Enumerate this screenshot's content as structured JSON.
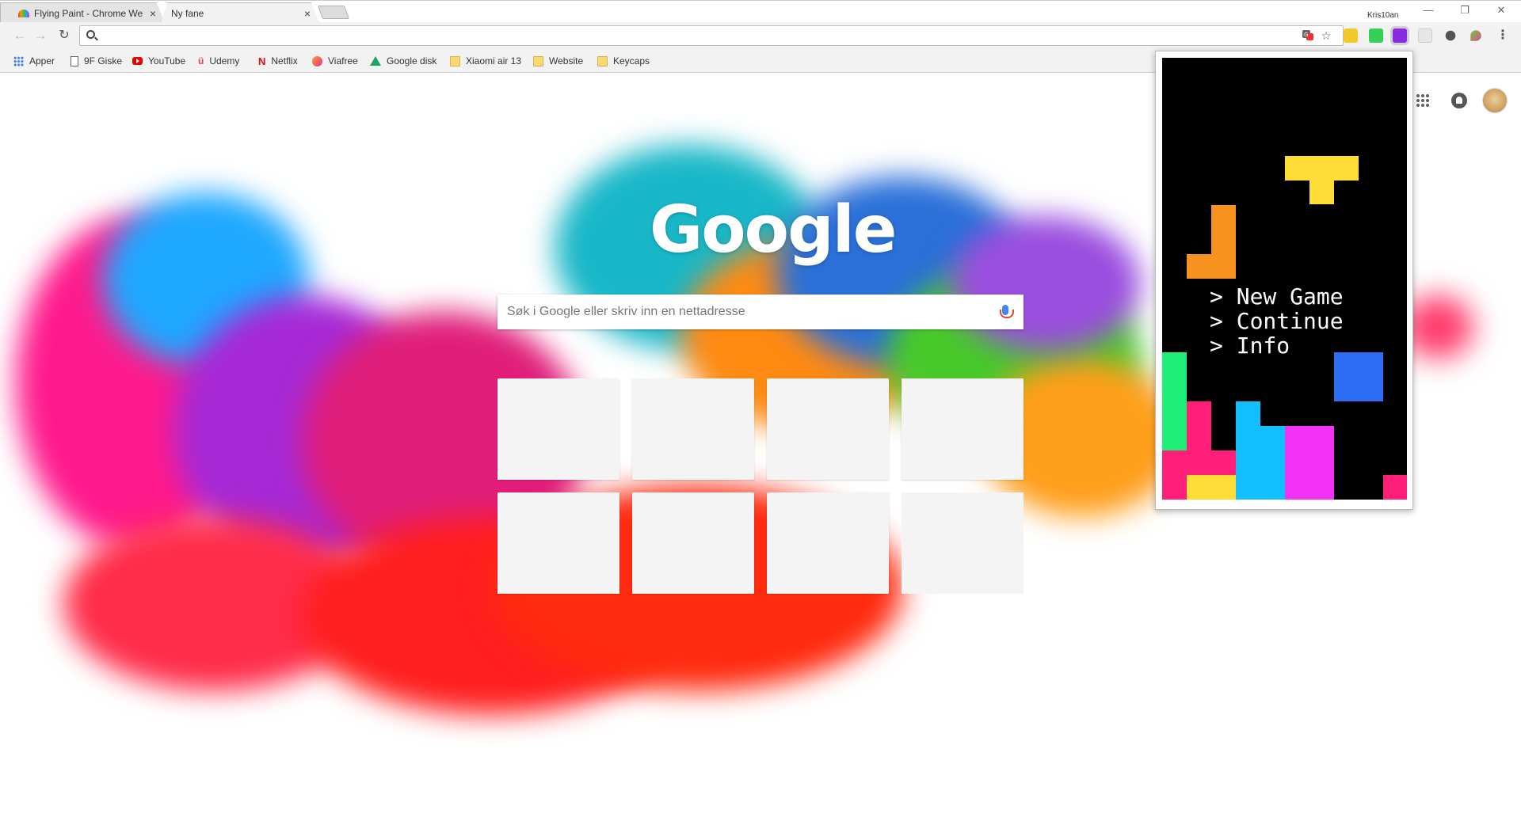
{
  "tabs": [
    {
      "label": "Flying Paint - Chrome We",
      "close": "×",
      "active": false
    },
    {
      "label": "Ny fane",
      "close": "×",
      "active": true
    }
  ],
  "window": {
    "user": "Kris10an",
    "minimize": "—",
    "restore": "❐",
    "close": "✕"
  },
  "toolbar": {
    "back": "←",
    "forward": "→",
    "reload": "↻",
    "address_value": "",
    "translate_icon": "translate-icon",
    "star": "☆",
    "menu": "⋮",
    "extensions": [
      "#f2c82b",
      "#33d155",
      "#8a2be2",
      "#d9d9d9",
      "#555555",
      "#7ac943"
    ]
  },
  "bookmarks": [
    {
      "label": "Apper",
      "icon": "apps-icon"
    },
    {
      "label": "9F Giske",
      "icon": "page-icon"
    },
    {
      "label": "YouTube",
      "icon": "youtube-icon"
    },
    {
      "label": "Udemy",
      "icon": "udemy-icon",
      "glyph": "ü"
    },
    {
      "label": "Netflix",
      "icon": "netflix-icon",
      "glyph": "N"
    },
    {
      "label": "Viafree",
      "icon": "viafree-icon"
    },
    {
      "label": "Google disk",
      "icon": "google-drive-icon"
    },
    {
      "label": "Xiaomi air 13",
      "icon": "folder-icon"
    },
    {
      "label": "Website",
      "icon": "folder-icon"
    },
    {
      "label": "Keycaps",
      "icon": "folder-icon"
    }
  ],
  "ntp": {
    "logo": "Google",
    "search_placeholder": "Søk i Google eller skriv inn en nettadresse",
    "tile_count": 8
  },
  "game": {
    "menu": [
      "> New Game",
      "> Continue",
      "> Info"
    ],
    "colors": {
      "yellow": "#fddd36",
      "orange": "#f7921e",
      "green": "#1fef78",
      "magenta": "#ff1e78",
      "cyan": "#14bfff",
      "pink": "#f232f5",
      "blue": "#2e6ef5"
    }
  }
}
